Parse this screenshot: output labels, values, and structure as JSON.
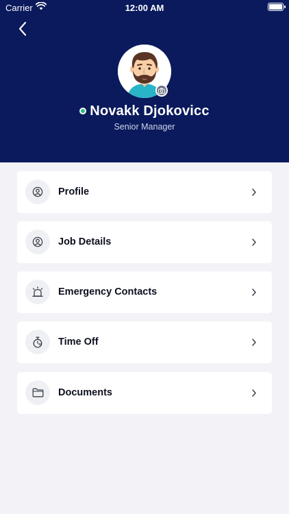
{
  "status_bar": {
    "carrier": "Carrier",
    "time": "12:00 AM",
    "wifi_icon": "wifi-icon",
    "battery_icon": "battery-icon"
  },
  "header": {
    "back_icon": "chevron-left-icon",
    "background_color": "#0a1a5c"
  },
  "profile": {
    "name": "Novakk Djokovicc",
    "title": "Senior Manager",
    "online_status_color": "#21c07a",
    "avatar_icon": "avatar-illustration",
    "camera_icon": "camera-icon"
  },
  "menu": {
    "items": [
      {
        "label": "Profile",
        "icon": "user-circle-icon"
      },
      {
        "label": "Job Details",
        "icon": "user-circle-icon"
      },
      {
        "label": "Emergency Contacts",
        "icon": "alarm-siren-icon"
      },
      {
        "label": "Time Off",
        "icon": "stopwatch-icon"
      },
      {
        "label": "Documents",
        "icon": "folder-icon"
      }
    ],
    "chevron_icon": "chevron-right-icon"
  }
}
